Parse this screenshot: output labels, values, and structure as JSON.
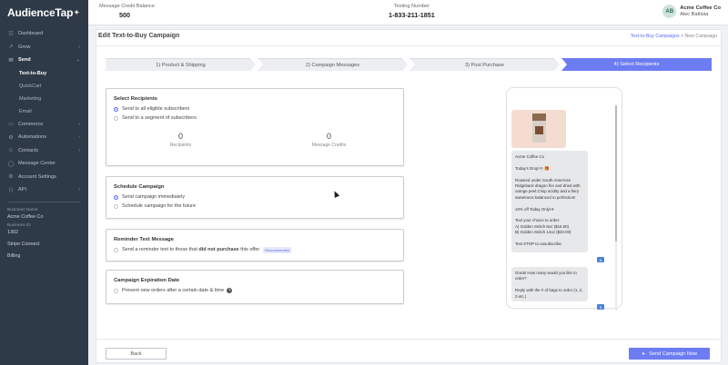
{
  "app": {
    "logo_text": "AudienceTap",
    "logo_mark": "✦"
  },
  "topbar": {
    "credit_label": "Message Credit Balance",
    "credit_value": "500",
    "texting_label": "Texting Number",
    "texting_value": "1-833-211-1851",
    "avatar_initials": "AB",
    "company": "Acme Coffee Co",
    "user": "Alec Battista"
  },
  "sidebar": {
    "items": [
      {
        "icon": "☷",
        "label": "Dashboard",
        "chevron": ""
      },
      {
        "icon": "↗",
        "label": "Grow",
        "chevron": "›"
      },
      {
        "icon": "✉",
        "label": "Send",
        "chevron": "⌄"
      },
      {
        "icon": "▭",
        "label": "Commerce",
        "chevron": "›"
      },
      {
        "icon": "⚙",
        "label": "Automations",
        "chevron": "›"
      },
      {
        "icon": "☺",
        "label": "Contacts",
        "chevron": "›"
      },
      {
        "icon": "◯",
        "label": "Message Center",
        "chevron": ""
      },
      {
        "icon": "⚙",
        "label": "Account Settings",
        "chevron": ""
      },
      {
        "icon": "⟨⟩",
        "label": "API",
        "chevron": "›"
      }
    ],
    "sub_items": [
      "Text-to-Buy",
      "QuickCart",
      "Marketing",
      "Email"
    ],
    "business_name_label": "Business Name",
    "business_name_value": "Acme Coffee Co",
    "business_id_label": "Business ID",
    "business_id_value": "1302",
    "stripe_link": "Stripe Connect",
    "billing_link": "Billing"
  },
  "page": {
    "title": "Edit Text-to-Buy Campaign",
    "crumb_link": "Text-to-Buy Campaigns",
    "crumb_sep": ">",
    "crumb_current": "New Campaign"
  },
  "steps": [
    "1) Product & Shipping",
    "2) Campaign Messages",
    "3) Post Purchase",
    "4) Select Recipients"
  ],
  "recipients": {
    "heading": "Select Recipients",
    "option_all": "Send to all eligible subscribers",
    "option_segment": "Send to a segment of subscribers",
    "recipients_count": "0",
    "recipients_label": "Recipients",
    "credits_count": "0",
    "credits_label": "Message Credits"
  },
  "schedule": {
    "heading": "Schedule Campaign",
    "option_now": "Send campaign immediately",
    "option_future": "Schedule campaign for the future"
  },
  "reminder": {
    "heading": "Reminder Text Message",
    "text_before": "Send a reminder text to those that ",
    "text_bold": "did not purchase",
    "text_after": " this offer",
    "badge": "Recommended"
  },
  "expiration": {
    "heading": "Campaign Expiration Date",
    "option": "Prevent new orders after a certain date & time",
    "help_icon": "?"
  },
  "preview": {
    "message1": "Acme Coffee Co\n\nToday's Drop!☕🎁\n\nRoasted under South American Ridgeback dragon fire and dried with orange peel.Crisp acidity and a fiery sweetness balanced to perfection!\n\n10% off Today Only!☀\n\nText your choice to order:\nA) Golden Snitch 8oz ($16.00)\nB) Golden Snitch 12oz ($20.00)\n\nText STOP to unsubscribe",
    "read1": "A",
    "message2": "Great! How many would you like to order?\n\nReply with the # of bags to order (1, 2, 3 etc.)",
    "read2": "5"
  },
  "buttons": {
    "back": "Back",
    "send": "Send Campaign Now",
    "send_icon": "➤"
  }
}
